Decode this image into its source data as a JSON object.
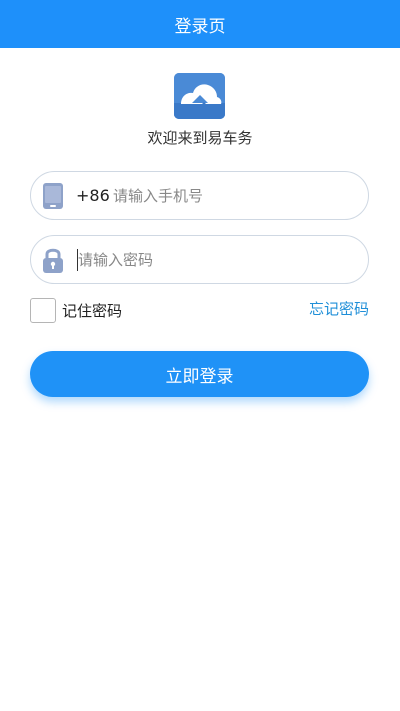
{
  "header": {
    "title": "登录页"
  },
  "brand": {
    "logo_icon": "cloud-logo-icon",
    "welcome": "欢迎来到易车务"
  },
  "form": {
    "phone": {
      "country_code": "+86",
      "placeholder": "请输入手机号",
      "icon": "phone-icon"
    },
    "password": {
      "placeholder": "请输入密码",
      "icon": "lock-icon"
    },
    "remember_label": "记住密码",
    "forgot_label": "忘记密码",
    "submit_label": "立即登录"
  },
  "colors": {
    "primary": "#1e90fa",
    "link": "#1f8fd8",
    "icon": "#8ea2c9"
  }
}
